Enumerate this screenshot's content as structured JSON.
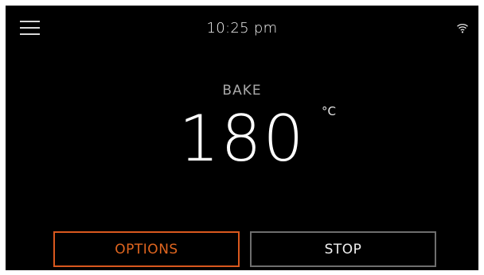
{
  "header": {
    "menu_icon": "hamburger-menu-icon",
    "time": "10:25 pm",
    "wifi_icon": "wifi-icon"
  },
  "main": {
    "mode": "BAKE",
    "temperature": "180",
    "unit": "°C"
  },
  "buttons": {
    "options_label": "OPTIONS",
    "stop_label": "STOP"
  },
  "colors": {
    "background": "#000000",
    "accent": "#d9581e",
    "secondary_border": "#6e6e6e",
    "text": "#ffffff",
    "muted_text": "#a9a9a9"
  }
}
